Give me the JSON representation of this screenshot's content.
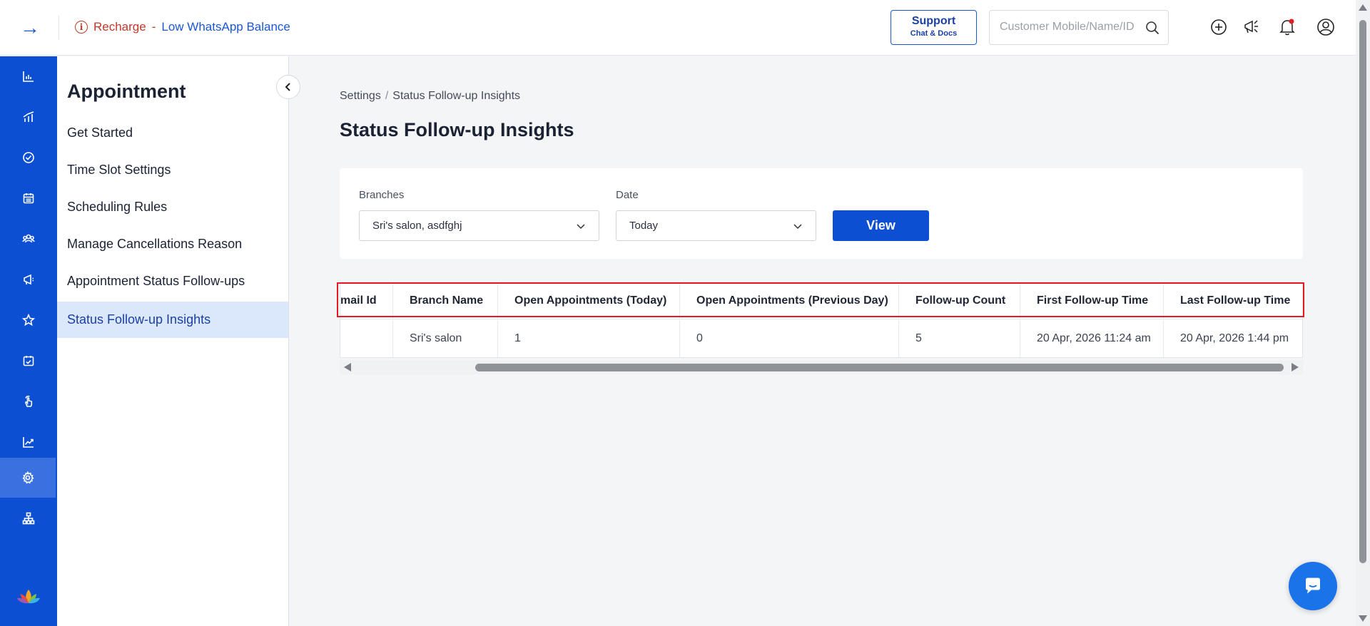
{
  "topbar": {
    "alert_info_glyph": "i",
    "alert_text": "Recharge",
    "alert_separator": "-",
    "alert_link": "Low WhatsApp Balance",
    "support_title": "Support",
    "support_subtitle": "Chat & Docs",
    "search_placeholder": "Customer Mobile/Name/ID"
  },
  "rail": {
    "items": [
      {
        "icon": "bar-chart-icon"
      },
      {
        "icon": "analytics-icon"
      },
      {
        "icon": "check-circle-icon"
      },
      {
        "icon": "calendar-icon"
      },
      {
        "icon": "customers-icon"
      },
      {
        "icon": "megaphone-icon"
      },
      {
        "icon": "star-icon"
      },
      {
        "icon": "calendar-check-icon"
      },
      {
        "icon": "hand-pointer-icon"
      },
      {
        "icon": "trend-icon"
      },
      {
        "icon": "gear-icon"
      },
      {
        "icon": "org-chart-icon"
      }
    ],
    "active_index": 10
  },
  "subnav": {
    "title": "Appointment",
    "items": [
      {
        "label": "Get Started"
      },
      {
        "label": "Time Slot Settings"
      },
      {
        "label": "Scheduling Rules"
      },
      {
        "label": "Manage Cancellations Reason"
      },
      {
        "label": "Appointment Status Follow-ups"
      },
      {
        "label": "Status Follow-up Insights"
      }
    ]
  },
  "breadcrumb": {
    "root": "Settings",
    "separator": "/",
    "current": "Status Follow-up Insights"
  },
  "page_title": "Status Follow-up Insights",
  "filters": {
    "branches_label": "Branches",
    "branches_value": "Sri's salon, asdfghj",
    "date_label": "Date",
    "date_value": "Today",
    "view_label": "View"
  },
  "table": {
    "headers": [
      "mail Id",
      "Branch Name",
      "Open Appointments (Today)",
      "Open Appointments (Previous Day)",
      "Follow-up Count",
      "First Follow-up Time",
      "Last Follow-up Time"
    ],
    "rows": [
      [
        "",
        "Sri's salon",
        "1",
        "0",
        "5",
        "20 Apr, 2026 11:24 am",
        "20 Apr, 2026 1:44 pm"
      ]
    ]
  },
  "colors": {
    "brand_blue": "#0c4fd3",
    "alert_red": "#c0392b",
    "highlight_red": "#e31b23",
    "active_nav_bg": "#dbe7fb"
  }
}
